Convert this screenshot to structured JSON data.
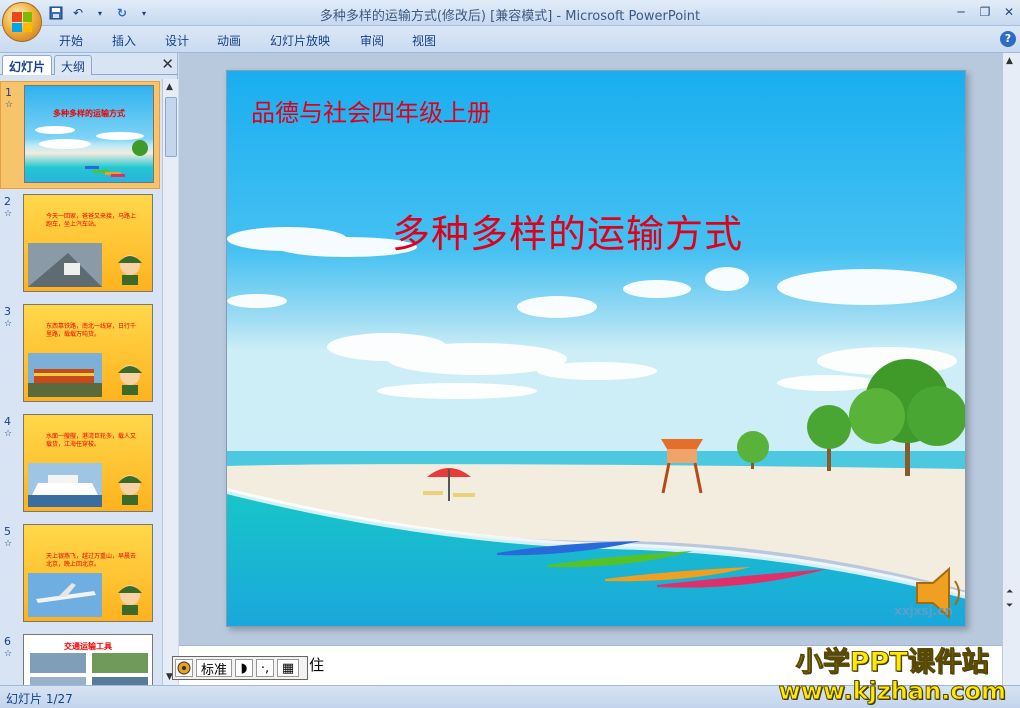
{
  "window": {
    "title": "多种多样的运输方式(修改后) [兼容模式] - Microsoft PowerPoint"
  },
  "ribbon": {
    "tabs": [
      "开始",
      "插入",
      "设计",
      "动画",
      "幻灯片放映",
      "审阅",
      "视图"
    ]
  },
  "left_pane": {
    "tabs": [
      "幻灯片",
      "大纲"
    ],
    "thumbnails": [
      {
        "num": "1",
        "title": "多种多样的运输方式",
        "selected": true
      },
      {
        "num": "2",
        "text": "今天一回家，爸爸又来接，马路上跑车，坐上汽车站。"
      },
      {
        "num": "3",
        "text": "东西靠铁路，南北一线穿，日行千里路，载载万吨货。"
      },
      {
        "num": "4",
        "text": "水面一艘艘，港湾巨轮多，载人又载货，江海任穿梭。"
      },
      {
        "num": "5",
        "text": "天上银燕飞，越过万重山，早晨去北京，晚上回北京。"
      },
      {
        "num": "6",
        "title": "交通运输工具"
      }
    ]
  },
  "slide": {
    "subtitle": "品德与社会四年级上册",
    "title": "多种多样的运输方式",
    "watermark": "xxjxsj.cn"
  },
  "notes": {
    "text": "住"
  },
  "ime": {
    "mode": "标准"
  },
  "status": {
    "slide_counter": "幻灯片 1/27"
  },
  "brand": {
    "name": "小学PPT课件站",
    "url": "www.kjzhan.com"
  },
  "colors": {
    "title_red": "#e0001b",
    "brand_yellow": "#ffea00",
    "sky": "#35b7f0",
    "selected_thumb": "#f8c46b"
  }
}
